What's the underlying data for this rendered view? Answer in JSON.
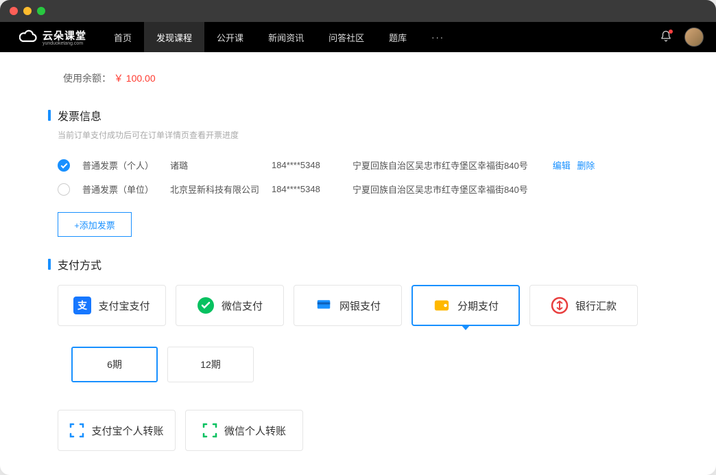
{
  "titlebar": {
    "type": "mac"
  },
  "logo": {
    "name": "云朵课堂",
    "sub": "yunduoketang.com"
  },
  "nav": {
    "items": [
      "首页",
      "发现课程",
      "公开课",
      "新闻资讯",
      "问答社区",
      "题库"
    ],
    "active_index": 1,
    "more": "···"
  },
  "balance": {
    "label": "使用余额：",
    "amount": "￥ 100.00"
  },
  "invoice": {
    "title": "发票信息",
    "subtitle": "当前订单支付成功后可在订单详情页查看开票进度",
    "rows": [
      {
        "checked": true,
        "type": "普通发票（个人）",
        "name": "诸璐",
        "phone": "184****5348",
        "addr": "宁夏回族自治区吴忠市红寺堡区幸福街840号",
        "edit": "编辑",
        "del": "删除"
      },
      {
        "checked": false,
        "type": "普通发票（单位）",
        "name": "北京昱新科技有限公司",
        "phone": "184****5348",
        "addr": "宁夏回族自治区吴忠市红寺堡区幸福街840号"
      }
    ],
    "add": "+添加发票"
  },
  "payment": {
    "title": "支付方式",
    "methods": [
      {
        "key": "alipay",
        "label": "支付宝支付"
      },
      {
        "key": "wechat",
        "label": "微信支付"
      },
      {
        "key": "bank",
        "label": "网银支付"
      },
      {
        "key": "installment",
        "label": "分期支付",
        "selected": true
      },
      {
        "key": "transfer",
        "label": "银行汇款"
      }
    ],
    "installments": [
      {
        "label": "6期",
        "selected": true
      },
      {
        "label": "12期"
      }
    ],
    "personal_transfer": [
      {
        "key": "alipay-p",
        "label": "支付宝个人转账"
      },
      {
        "key": "wechat-p",
        "label": "微信个人转账"
      }
    ]
  }
}
